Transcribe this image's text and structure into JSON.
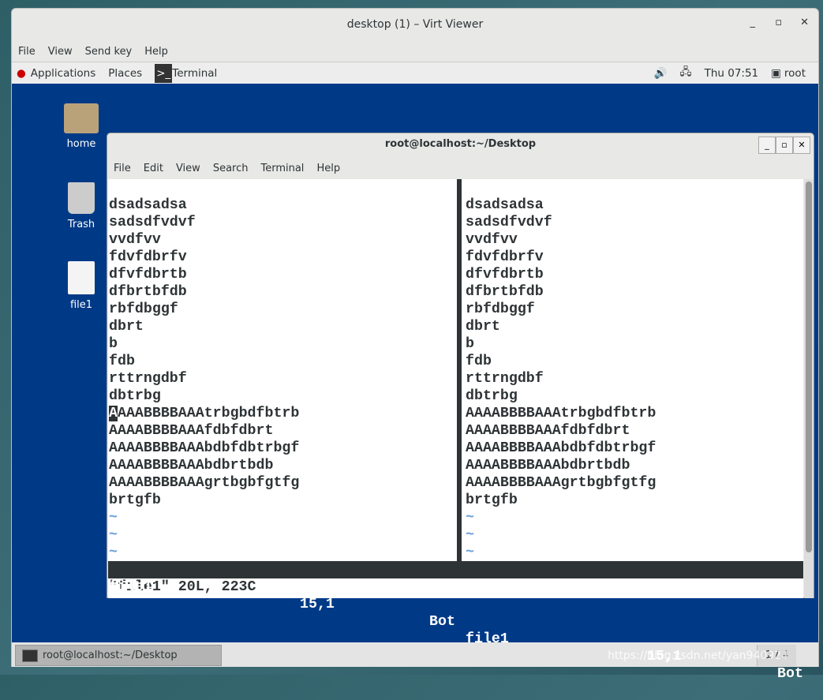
{
  "viewer": {
    "title": "desktop (1) – Virt Viewer",
    "menu": [
      "File",
      "View",
      "Send key",
      "Help"
    ]
  },
  "panel": {
    "applications": "Applications",
    "places": "Places",
    "terminal": "Terminal",
    "clock": "Thu 07:51",
    "user": "root"
  },
  "desktop_icons": [
    {
      "label": "home",
      "icon": "folder-home-icon"
    },
    {
      "label": "Trash",
      "icon": "trash-icon"
    },
    {
      "label": "file1",
      "icon": "file-icon"
    }
  ],
  "terminal": {
    "title": "root@localhost:~/Desktop",
    "menu": [
      "File",
      "Edit",
      "View",
      "Search",
      "Terminal",
      "Help"
    ],
    "lines": [
      "dsadsadsa",
      "sadsdfvdvf",
      "vvdfvv",
      "fdvfdbrfv",
      "dfvfdbrtb",
      "dfbrtbfdb",
      "rbfdbggf",
      "dbrt",
      "b",
      "fdb",
      "rttrngdbf",
      "dbtrbg",
      "AAAABBBBAAAtrbgbdfbtrb",
      "AAAABBBBAAAfdbfdbrt",
      "AAAABBBBAAAbdbfdbtrbgf",
      "AAAABBBBAAAbdbrtbdb",
      "AAAABBBBAAAgrtbgbfgtfg",
      "brtgfb"
    ],
    "tilde": "~",
    "status_left": {
      "file": "file1",
      "pos": "15,1",
      "where": "Bot"
    },
    "status_right": {
      "file": "file1",
      "pos": "15,1",
      "where": "Bot"
    },
    "command_line": "\"file1\" 20L, 223C"
  },
  "taskbar": {
    "item": "root@localhost:~/Desktop",
    "workspace": "1 / 4"
  },
  "watermark": "https://blog.csdn.net/yan940924"
}
